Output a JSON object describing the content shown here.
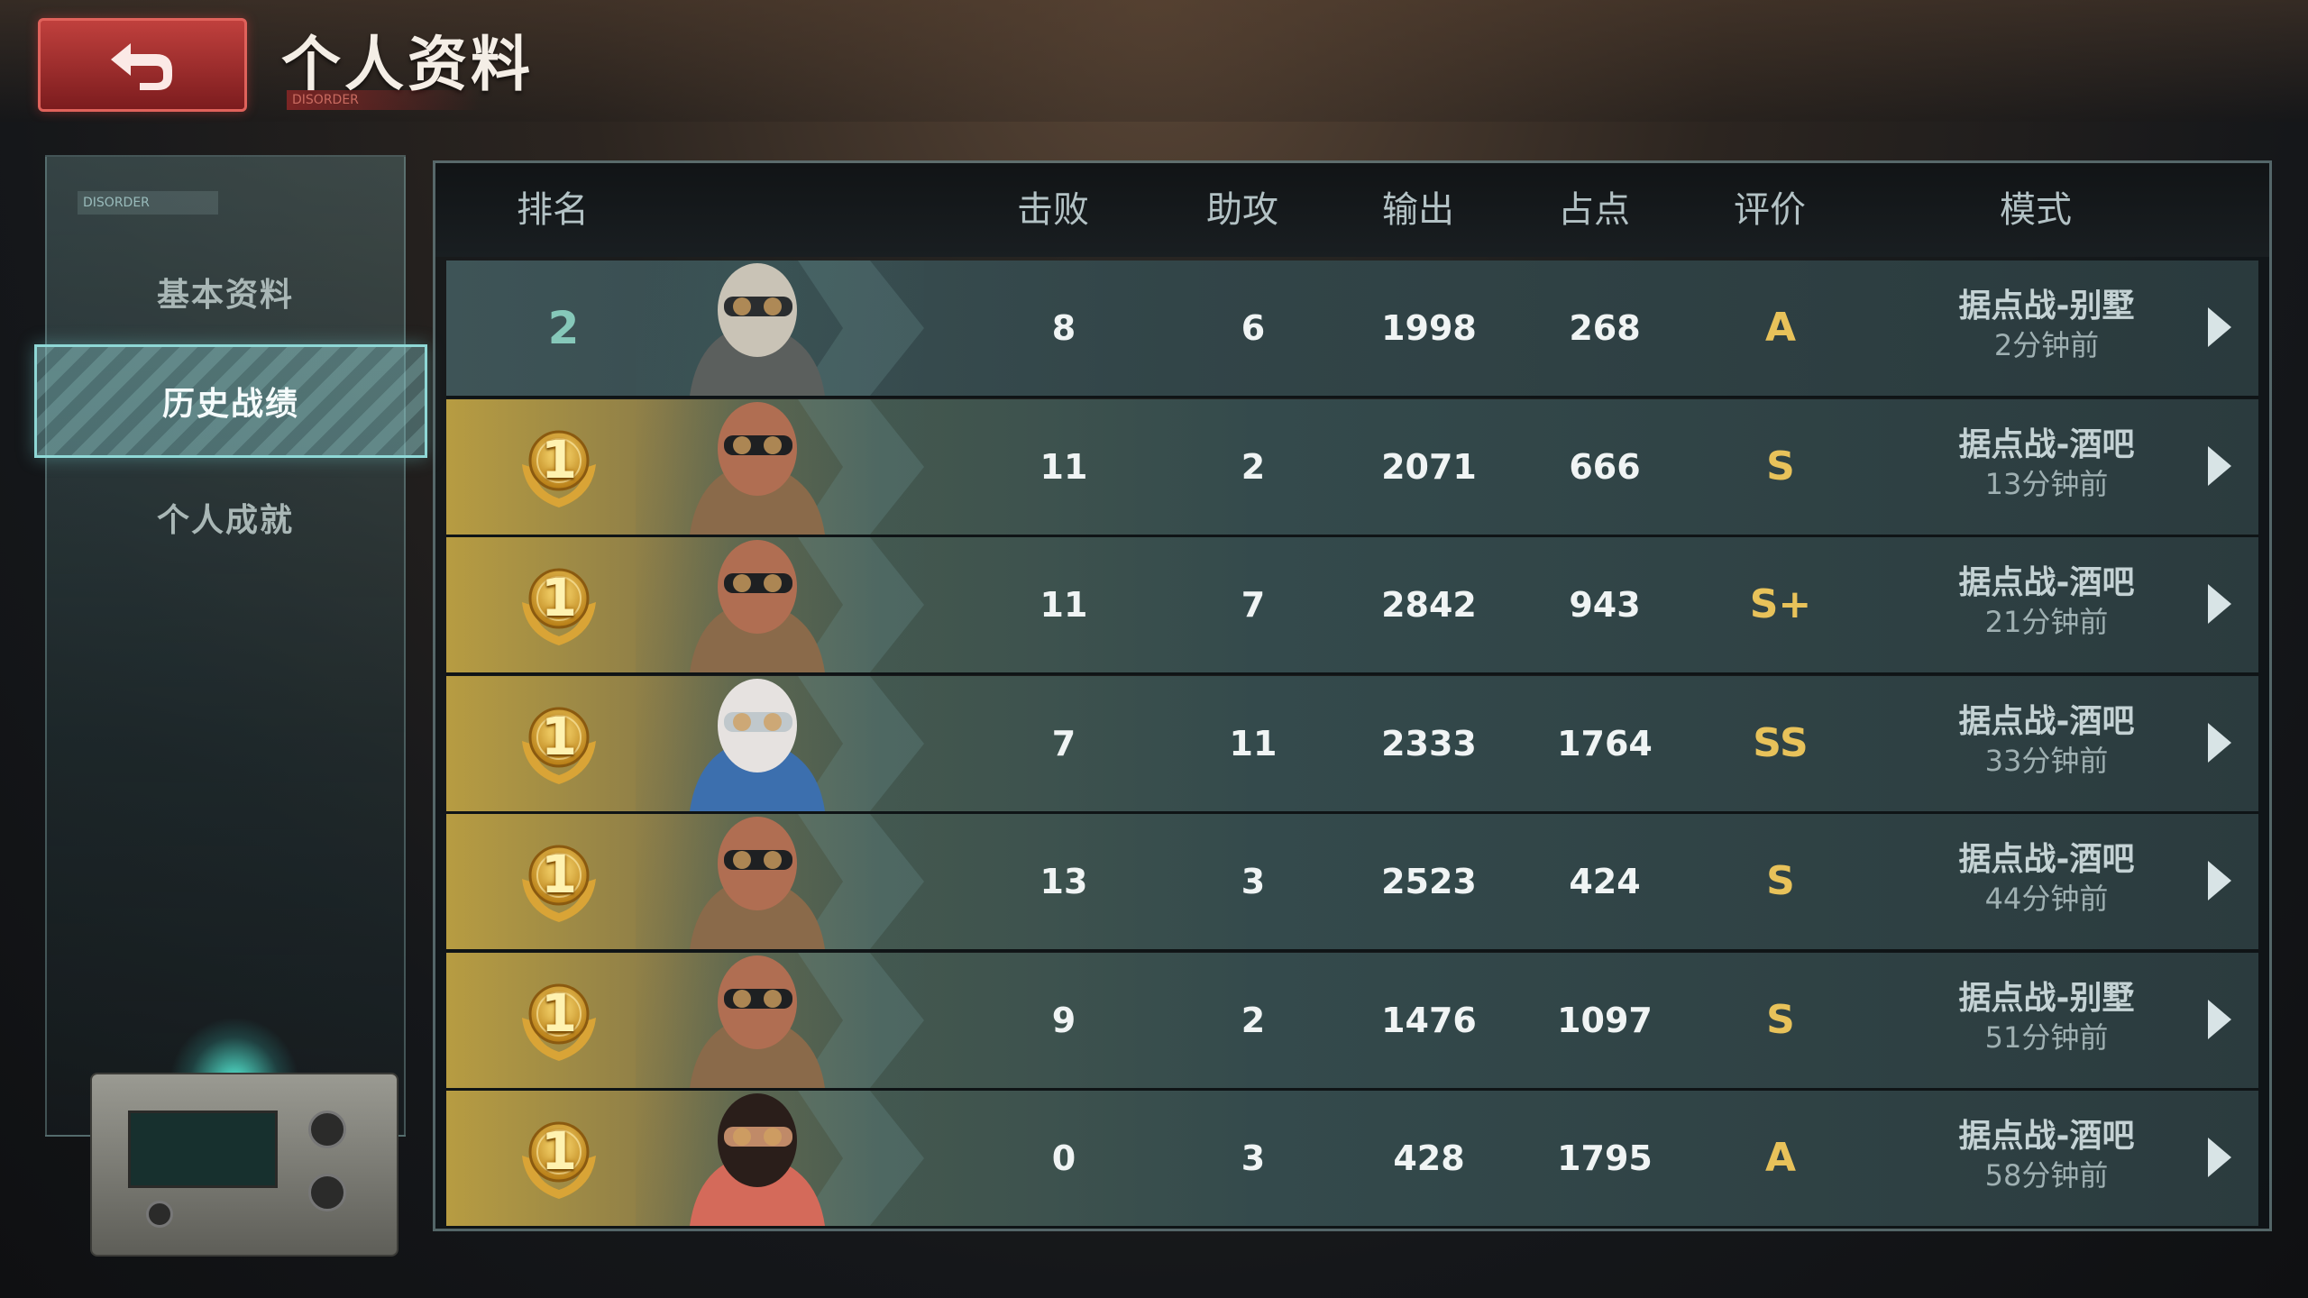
{
  "header": {
    "title": "个人资料",
    "subtitle_tag": "DISORDER",
    "back_icon": "back-arrow-icon"
  },
  "sidebar": {
    "tag": "DISORDER",
    "items": [
      {
        "label": "基本资料",
        "active": false
      },
      {
        "label": "历史战绩",
        "active": true
      },
      {
        "label": "个人成就",
        "active": false
      }
    ]
  },
  "table": {
    "columns": [
      "排名",
      "击败",
      "助攻",
      "输出",
      "占点",
      "评价",
      "模式"
    ],
    "rows": [
      {
        "rank": "2",
        "medal": false,
        "avatar": "masked-soldier",
        "kills": "8",
        "assists": "6",
        "output": "1998",
        "capture": "268",
        "grade": "A",
        "mode": "据点战-别墅",
        "time": "2分钟前"
      },
      {
        "rank": "1",
        "medal": true,
        "avatar": "goggles-gasmask",
        "kills": "11",
        "assists": "2",
        "output": "2071",
        "capture": "666",
        "grade": "S",
        "mode": "据点战-酒吧",
        "time": "13分钟前"
      },
      {
        "rank": "1",
        "medal": true,
        "avatar": "goggles-gasmask",
        "kills": "11",
        "assists": "7",
        "output": "2842",
        "capture": "943",
        "grade": "S+",
        "mode": "据点战-酒吧",
        "time": "21分钟前"
      },
      {
        "rank": "1",
        "medal": true,
        "avatar": "white-hair-goggles",
        "kills": "7",
        "assists": "11",
        "output": "2333",
        "capture": "1764",
        "grade": "SS",
        "mode": "据点战-酒吧",
        "time": "33分钟前"
      },
      {
        "rank": "1",
        "medal": true,
        "avatar": "goggles-gasmask",
        "kills": "13",
        "assists": "3",
        "output": "2523",
        "capture": "424",
        "grade": "S",
        "mode": "据点战-酒吧",
        "time": "44分钟前"
      },
      {
        "rank": "1",
        "medal": true,
        "avatar": "goggles-gasmask",
        "kills": "9",
        "assists": "2",
        "output": "1476",
        "capture": "1097",
        "grade": "S",
        "mode": "据点战-别墅",
        "time": "51分钟前"
      },
      {
        "rank": "1",
        "medal": true,
        "avatar": "dark-hair-headphones",
        "kills": "0",
        "assists": "3",
        "output": "428",
        "capture": "1795",
        "grade": "A",
        "mode": "据点战-酒吧",
        "time": "58分钟前"
      }
    ]
  },
  "colors": {
    "accent_teal": "#8fd8d6",
    "grade_gold": "#e8c25a",
    "back_red": "#c0403d"
  }
}
